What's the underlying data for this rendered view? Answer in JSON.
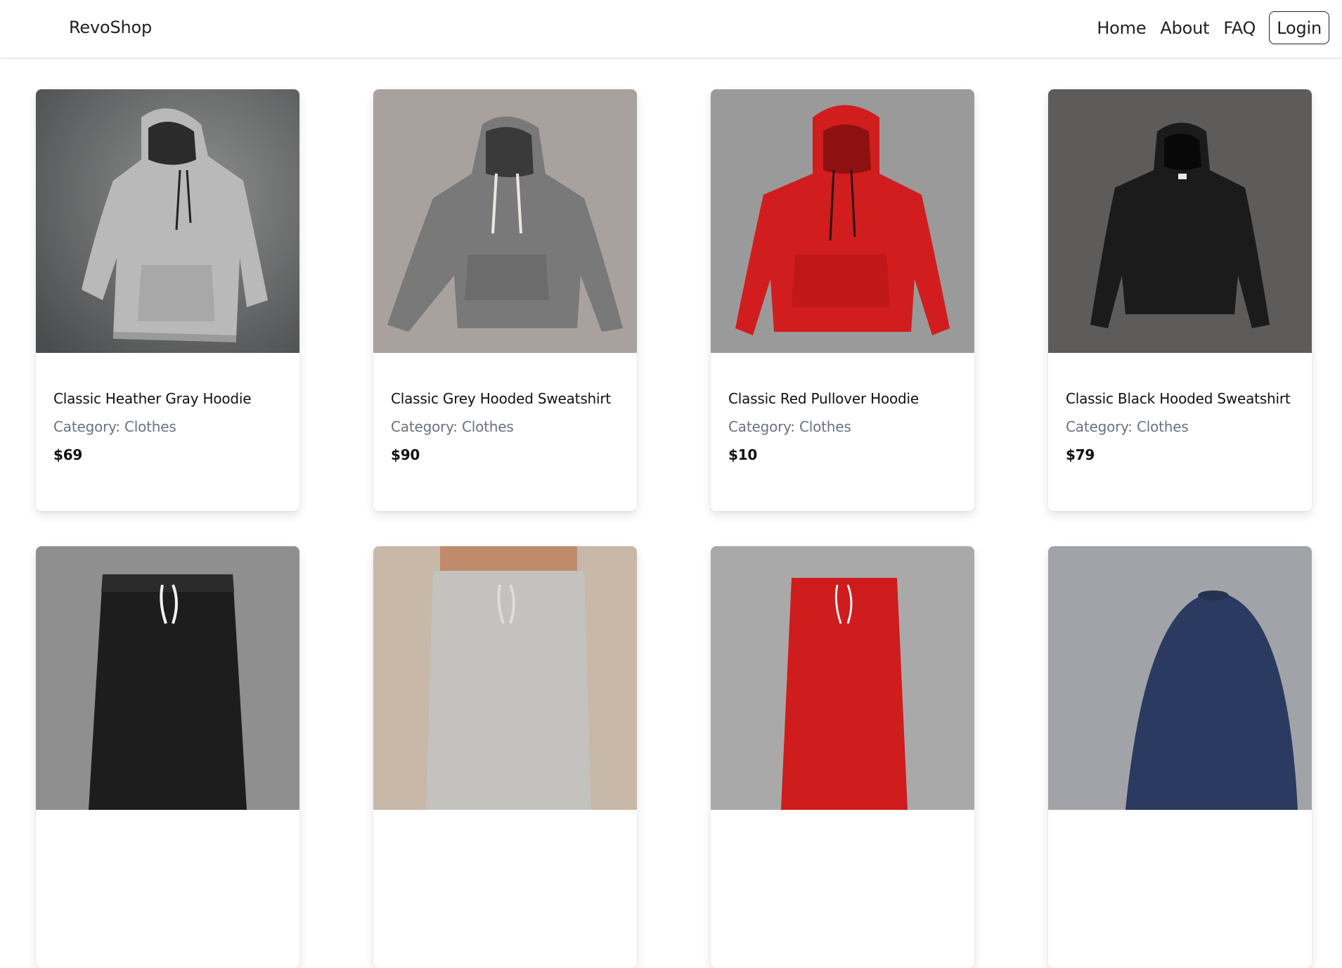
{
  "navbar": {
    "brand": "RevoShop",
    "links": [
      "Home",
      "About",
      "FAQ"
    ],
    "login_label": "Login"
  },
  "products": [
    {
      "title": "Classic Heather Gray Hoodie",
      "category": "Category: Clothes",
      "price": "$69",
      "image": "hoodie-heather-gray-image"
    },
    {
      "title": "Classic Grey Hooded Sweatshirt",
      "category": "Category: Clothes",
      "price": "$90",
      "image": "hoodie-grey-image"
    },
    {
      "title": "Classic Red Pullover Hoodie",
      "category": "Category: Clothes",
      "price": "$10",
      "image": "hoodie-red-image"
    },
    {
      "title": "Classic Black Hooded Sweatshirt",
      "category": "Category: Clothes",
      "price": "$79",
      "image": "hoodie-black-image"
    },
    {
      "image": "joggers-black-image"
    },
    {
      "image": "joggers-light-gray-image"
    },
    {
      "image": "joggers-red-image"
    },
    {
      "image": "cap-navy-image"
    }
  ],
  "colors": {
    "card_bg": "#ffffff",
    "category_text": "#6b7280",
    "hoodie_heather_gray": "#b9b9b9",
    "hoodie_grey": "#7a7979",
    "hoodie_red": "#d11d1d",
    "hoodie_black": "#1b1b1b",
    "cap_navy": "#2a3a60"
  }
}
